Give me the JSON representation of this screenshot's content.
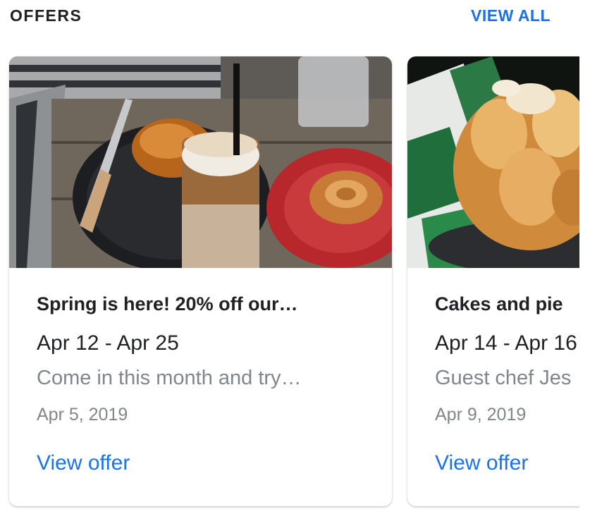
{
  "header": {
    "title": "OFFERS",
    "view_all": "VIEW ALL"
  },
  "offers": [
    {
      "title": "Spring is here! 20% off our…",
      "dates": "Apr 12 - Apr 25",
      "description": "Come in this month and try…",
      "posted": "Apr 5, 2019",
      "link": "View offer",
      "image": "iced coffee and pastries on a tray"
    },
    {
      "title": "Cakes and pie",
      "dates": "Apr 14 - Apr 16",
      "description": "Guest chef Jes",
      "posted": "Apr 9, 2019",
      "link": "View offer",
      "image": "bundt cake with powdered sugar"
    }
  ],
  "colors": {
    "accent": "#1a73e8",
    "text_primary": "#202124",
    "text_secondary": "#80868b"
  }
}
